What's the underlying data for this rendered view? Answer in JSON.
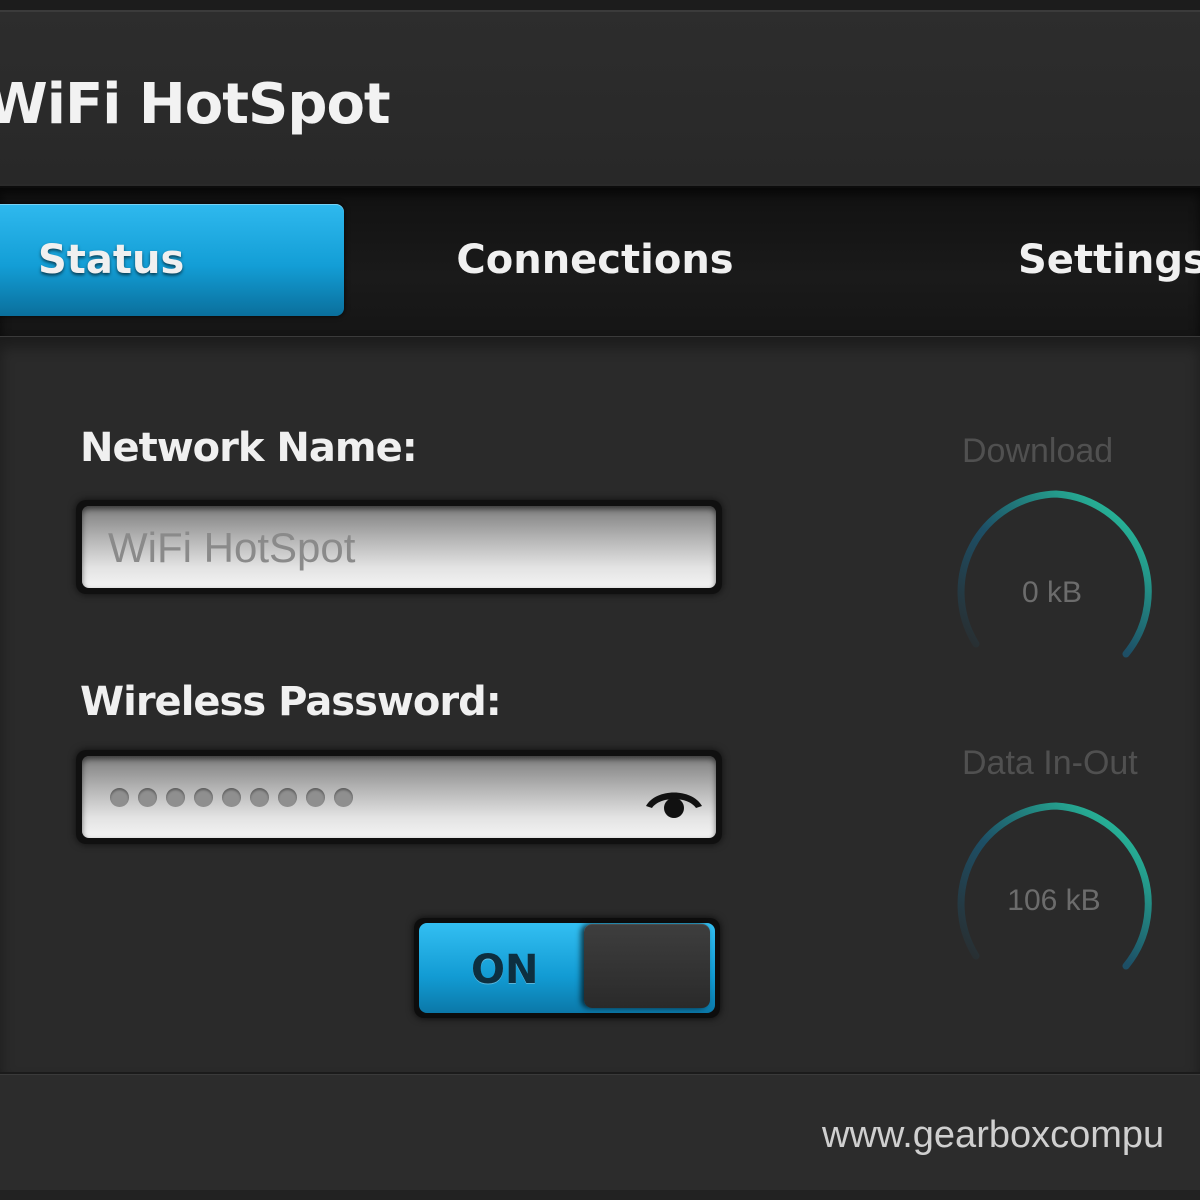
{
  "app": {
    "title": "WiFi HotSpot"
  },
  "tabs": [
    {
      "label": "Status",
      "active": true
    },
    {
      "label": "Connections",
      "active": false
    },
    {
      "label": "Settings",
      "active": false
    }
  ],
  "form": {
    "network_label": "Network Name:",
    "network_placeholder": "WiFi HotSpot",
    "password_label": "Wireless Password:",
    "password_masked_length": 9,
    "show_password_icon": "eye-icon"
  },
  "toggle": {
    "label": "ON",
    "state": "on"
  },
  "gauges": {
    "download": {
      "label": "Download",
      "value": "0 kB"
    },
    "data_in_out": {
      "label": "Data In-Out",
      "value": "106 kB"
    }
  },
  "footer": {
    "link": "www.gearboxcompu"
  },
  "colors": {
    "accent": "#1aa7e0",
    "gauge_accent": "#2ad6a8",
    "background": "#2a2a2a"
  }
}
